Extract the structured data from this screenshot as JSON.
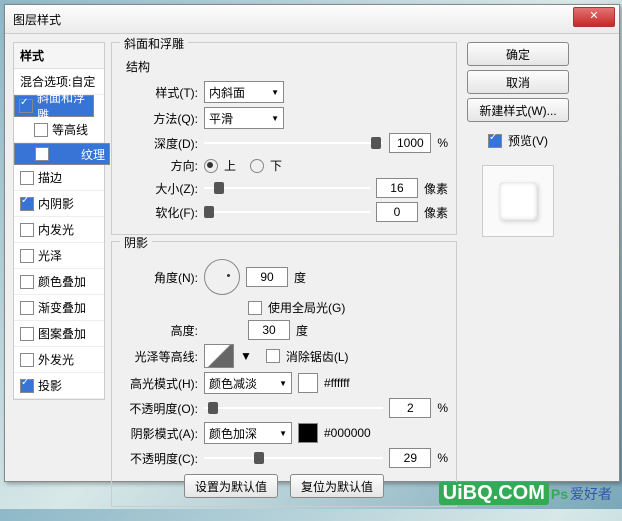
{
  "title": "图层样式",
  "left": {
    "head": "样式",
    "blend": "混合选项:自定",
    "items": [
      {
        "label": "斜面和浮雕",
        "checked": true,
        "selected": true,
        "sub": false
      },
      {
        "label": "等高线",
        "checked": false,
        "selected": false,
        "sub": true
      },
      {
        "label": "纹理",
        "checked": false,
        "selected": true,
        "sub": true
      },
      {
        "label": "描边",
        "checked": false,
        "selected": false,
        "sub": false
      },
      {
        "label": "内阴影",
        "checked": true,
        "selected": false,
        "sub": false
      },
      {
        "label": "内发光",
        "checked": false,
        "selected": false,
        "sub": false
      },
      {
        "label": "光泽",
        "checked": false,
        "selected": false,
        "sub": false
      },
      {
        "label": "颜色叠加",
        "checked": false,
        "selected": false,
        "sub": false
      },
      {
        "label": "渐变叠加",
        "checked": false,
        "selected": false,
        "sub": false
      },
      {
        "label": "图案叠加",
        "checked": false,
        "selected": false,
        "sub": false
      },
      {
        "label": "外发光",
        "checked": false,
        "selected": false,
        "sub": false
      },
      {
        "label": "投影",
        "checked": true,
        "selected": false,
        "sub": false
      }
    ]
  },
  "mid": {
    "fs1": "斜面和浮雕",
    "struct": "结构",
    "styleL": "样式(T):",
    "styleV": "内斜面",
    "methodL": "方法(Q):",
    "methodV": "平滑",
    "depthL": "深度(D):",
    "depthV": "1000",
    "pct": "%",
    "dirL": "方向:",
    "up": "上",
    "down": "下",
    "sizeL": "大小(Z):",
    "sizeV": "16",
    "px": "像素",
    "softL": "软化(F):",
    "softV": "0",
    "fs2": "阴影",
    "angleL": "角度(N):",
    "angleV": "90",
    "deg": "度",
    "globalL": "使用全局光(G)",
    "altL": "高度:",
    "altV": "30",
    "glossL": "光泽等高线:",
    "aaL": "消除锯齿(L)",
    "hiL": "高光模式(H):",
    "hiV": "颜色减淡",
    "hiHex": "#ffffff",
    "opL": "不透明度(O):",
    "opV": "2",
    "shL": "阴影模式(A):",
    "shV": "颜色加深",
    "shHex": "#000000",
    "op2L": "不透明度(C):",
    "op2V": "29",
    "defBtn": "设置为默认值",
    "resBtn": "复位为默认值"
  },
  "right": {
    "ok": "确定",
    "cancel": "取消",
    "new": "新建样式(W)...",
    "prev": "预览(V)"
  },
  "watermark": {
    "u": "UiBQ.COM",
    "p": "Ps",
    "t": "爱好者"
  }
}
